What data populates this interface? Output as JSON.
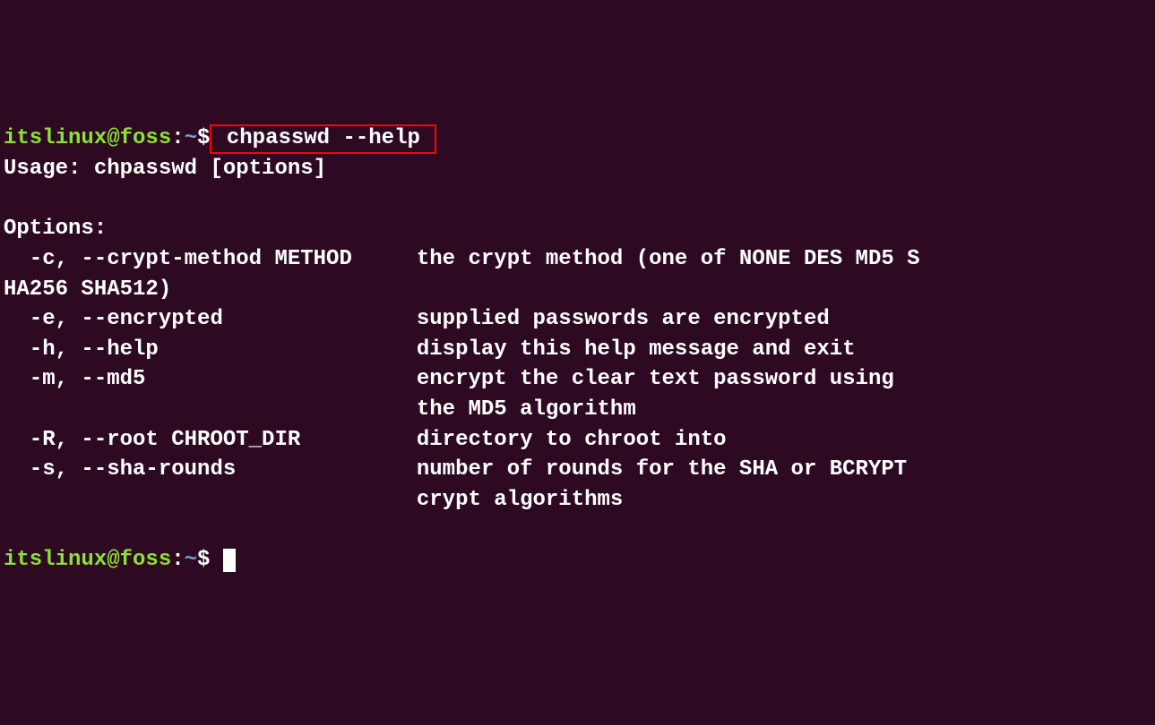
{
  "prompt1": {
    "user": "itslinux",
    "at": "@",
    "host": "foss",
    "colon": ":",
    "path": "~",
    "dollar": "$",
    "command": " chpasswd --help "
  },
  "output": {
    "l1": "Usage: chpasswd [options]",
    "l2": "",
    "l3": "Options:",
    "l4": "  -c, --crypt-method METHOD     the crypt method (one of NONE DES MD5 S",
    "l5": "HA256 SHA512)",
    "l6": "  -e, --encrypted               supplied passwords are encrypted",
    "l7": "  -h, --help                    display this help message and exit",
    "l8": "  -m, --md5                     encrypt the clear text password using",
    "l9": "                                the MD5 algorithm",
    "l10": "  -R, --root CHROOT_DIR         directory to chroot into",
    "l11": "  -s, --sha-rounds              number of rounds for the SHA or BCRYPT",
    "l12": "                                crypt algorithms",
    "l13": ""
  },
  "prompt2": {
    "user": "itslinux",
    "at": "@",
    "host": "foss",
    "colon": ":",
    "path": "~",
    "dollar": "$"
  }
}
